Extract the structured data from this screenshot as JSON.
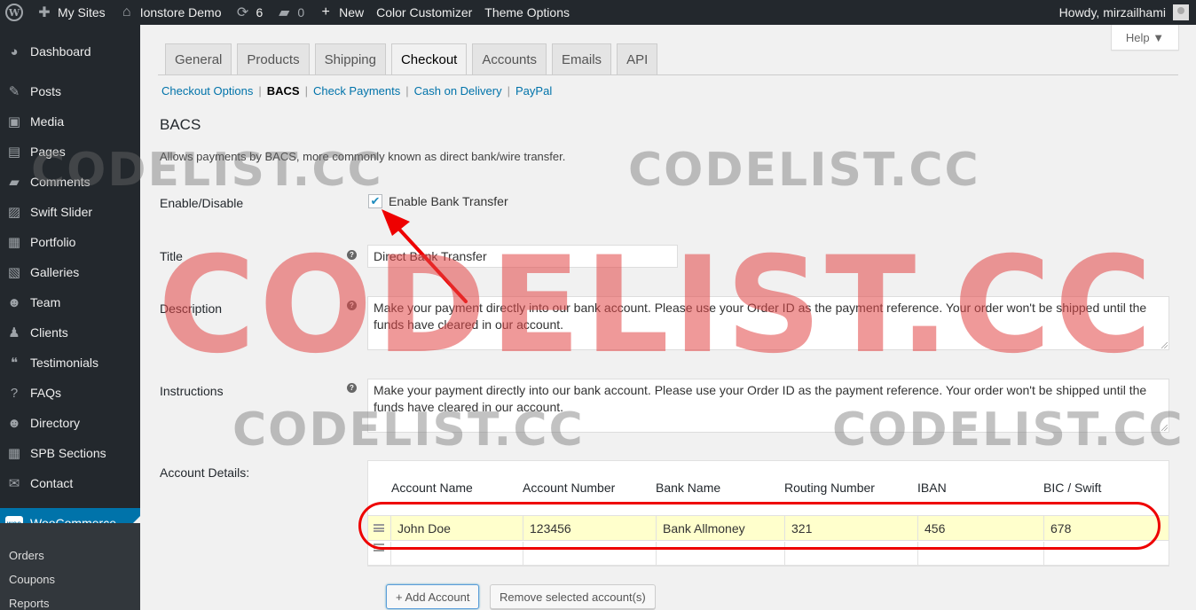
{
  "admin_bar": {
    "my_sites": "My Sites",
    "site_name": "Ionstore Demo",
    "updates_count": "6",
    "comments_count": "0",
    "new_label": "New",
    "color_customizer": "Color Customizer",
    "theme_options": "Theme Options",
    "howdy": "Howdy, mirzailhami"
  },
  "sidebar": {
    "items": [
      {
        "label": "Dashboard",
        "icon": "dashboard-icon",
        "glyph": "◕"
      },
      {
        "label": "Posts",
        "icon": "pin-icon",
        "glyph": "✎"
      },
      {
        "label": "Media",
        "icon": "media-icon",
        "glyph": "▣"
      },
      {
        "label": "Pages",
        "icon": "pages-icon",
        "glyph": "▤"
      },
      {
        "label": "Comments",
        "icon": "comment-icon",
        "glyph": "▰"
      },
      {
        "label": "Swift Slider",
        "icon": "slider-icon",
        "glyph": "▨"
      },
      {
        "label": "Portfolio",
        "icon": "portfolio-icon",
        "glyph": "▦"
      },
      {
        "label": "Galleries",
        "icon": "gallery-icon",
        "glyph": "▧"
      },
      {
        "label": "Team",
        "icon": "team-icon",
        "glyph": "☻"
      },
      {
        "label": "Clients",
        "icon": "clients-icon",
        "glyph": "♟"
      },
      {
        "label": "Testimonials",
        "icon": "quote-icon",
        "glyph": "❝"
      },
      {
        "label": "FAQs",
        "icon": "help-icon",
        "glyph": "?"
      },
      {
        "label": "Directory",
        "icon": "directory-icon",
        "glyph": "☻"
      },
      {
        "label": "SPB Sections",
        "icon": "sections-icon",
        "glyph": "▦"
      },
      {
        "label": "Contact",
        "icon": "mail-icon",
        "glyph": "✉"
      }
    ],
    "woocommerce": "WooCommerce",
    "woo_badge": "woo",
    "submenu": [
      "Orders",
      "Coupons",
      "Reports"
    ]
  },
  "help_button": "Help ▼",
  "tabs": [
    "General",
    "Products",
    "Shipping",
    "Checkout",
    "Accounts",
    "Emails",
    "API"
  ],
  "active_tab": "Checkout",
  "sections": {
    "checkout_options": "Checkout Options",
    "bacs": "BACS",
    "check_payments": "Check Payments",
    "cash_on_delivery": "Cash on Delivery",
    "paypal": "PayPal",
    "separator": "|"
  },
  "bacs": {
    "heading": "BACS",
    "description": "Allows payments by BACS, more commonly known as direct bank/wire transfer.",
    "enable_label": "Enable/Disable",
    "enable_checkbox_label": "Enable Bank Transfer",
    "enabled": true,
    "title_label": "Title",
    "title_value": "Direct Bank Transfer",
    "description_label": "Description",
    "description_value": "Make your payment directly into our bank account. Please use your Order ID as the payment reference. Your order won't be shipped until the funds have cleared in our account.",
    "instructions_label": "Instructions",
    "instructions_value": "Make your payment directly into our bank account. Please use your Order ID as the payment reference. Your order won't be shipped until the funds have cleared in our account.",
    "account_details_label": "Account Details:",
    "help_tip": "?"
  },
  "accounts_table": {
    "headers": [
      "Account Name",
      "Account Number",
      "Bank Name",
      "Routing Number",
      "IBAN",
      "BIC / Swift"
    ],
    "rows": [
      [
        "John Doe",
        "123456",
        "Bank Allmoney",
        "321",
        "456",
        "678"
      ]
    ],
    "add_button": "+ Add Account",
    "remove_button": "Remove selected account(s)"
  },
  "watermark": "CODELIST.CC",
  "colors": {
    "admin_bar_bg": "#23282d",
    "accent_blue": "#0073aa",
    "highlight_row": "#ffffcc",
    "annotation_red": "#e00000"
  }
}
